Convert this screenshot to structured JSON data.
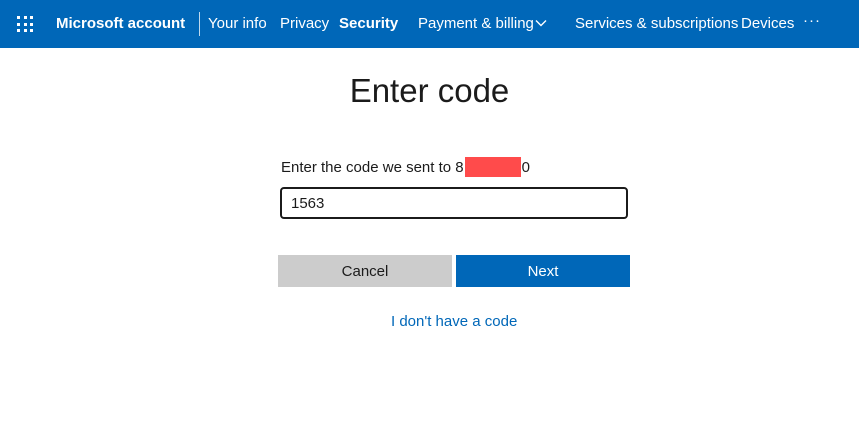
{
  "header": {
    "brand": "Microsoft account",
    "nav": {
      "your_info": "Your info",
      "privacy": "Privacy",
      "security": "Security",
      "payment_billing": "Payment & billing",
      "services_subscriptions": "Services & subscriptions",
      "devices": "Devices",
      "more": "···"
    }
  },
  "main": {
    "title": "Enter code",
    "prompt_prefix": "Enter the code we sent to 8",
    "prompt_suffix": "0",
    "code_value": "1563",
    "cancel_label": "Cancel",
    "next_label": "Next",
    "no_code_link": "I don't have a code"
  },
  "colors": {
    "brand_blue": "#0067b8",
    "cancel_gray": "#cccccc",
    "redaction": "#ff4b4b"
  }
}
